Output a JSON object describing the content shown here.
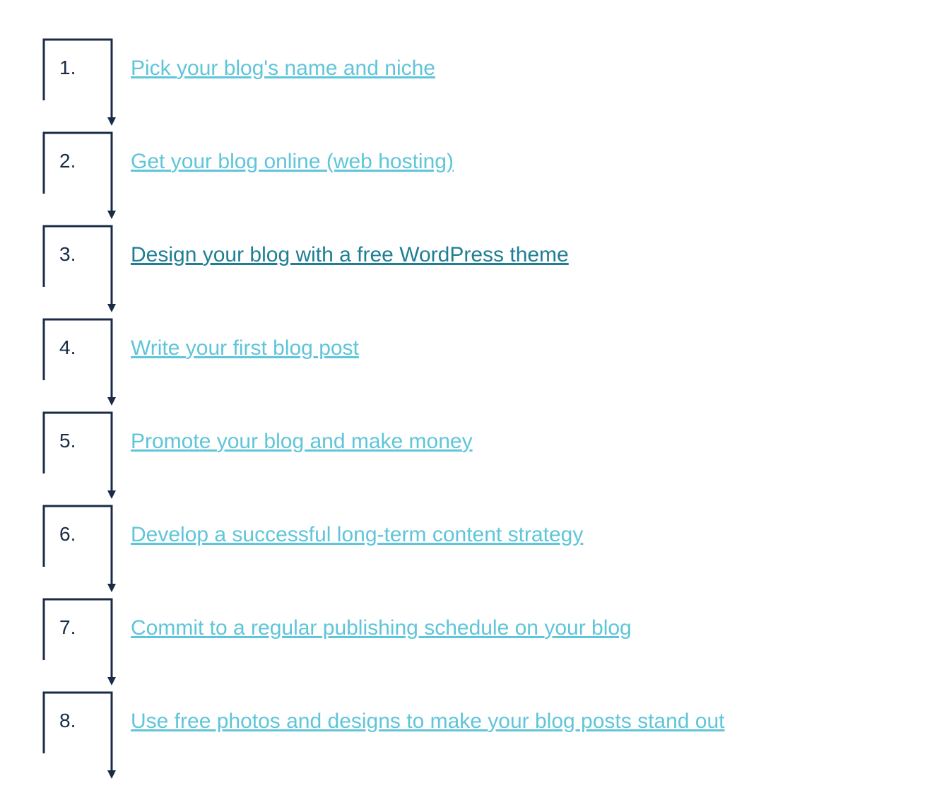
{
  "colors": {
    "linkLight": "#5fc5d9",
    "linkDark": "#1f7e94",
    "ink": "#1a2b47"
  },
  "steps": [
    {
      "num": "1.",
      "label": "Pick your blog's name and niche",
      "colorClass": "color-light"
    },
    {
      "num": "2.",
      "label": "Get your blog online (web hosting)",
      "colorClass": "color-light"
    },
    {
      "num": "3.",
      "label": "Design your blog with a free WordPress theme",
      "colorClass": "color-dark"
    },
    {
      "num": "4.",
      "label": "Write your first blog post",
      "colorClass": "color-light"
    },
    {
      "num": "5.",
      "label": "Promote your blog and make money",
      "colorClass": "color-light"
    },
    {
      "num": "6.",
      "label": "Develop a successful long-term content strategy",
      "colorClass": "color-light"
    },
    {
      "num": "7.",
      "label": "Commit to a regular publishing schedule on your blog",
      "colorClass": "color-light"
    },
    {
      "num": "8.",
      "label": "Use free photos and designs to make your blog posts stand out",
      "colorClass": "color-light"
    }
  ]
}
